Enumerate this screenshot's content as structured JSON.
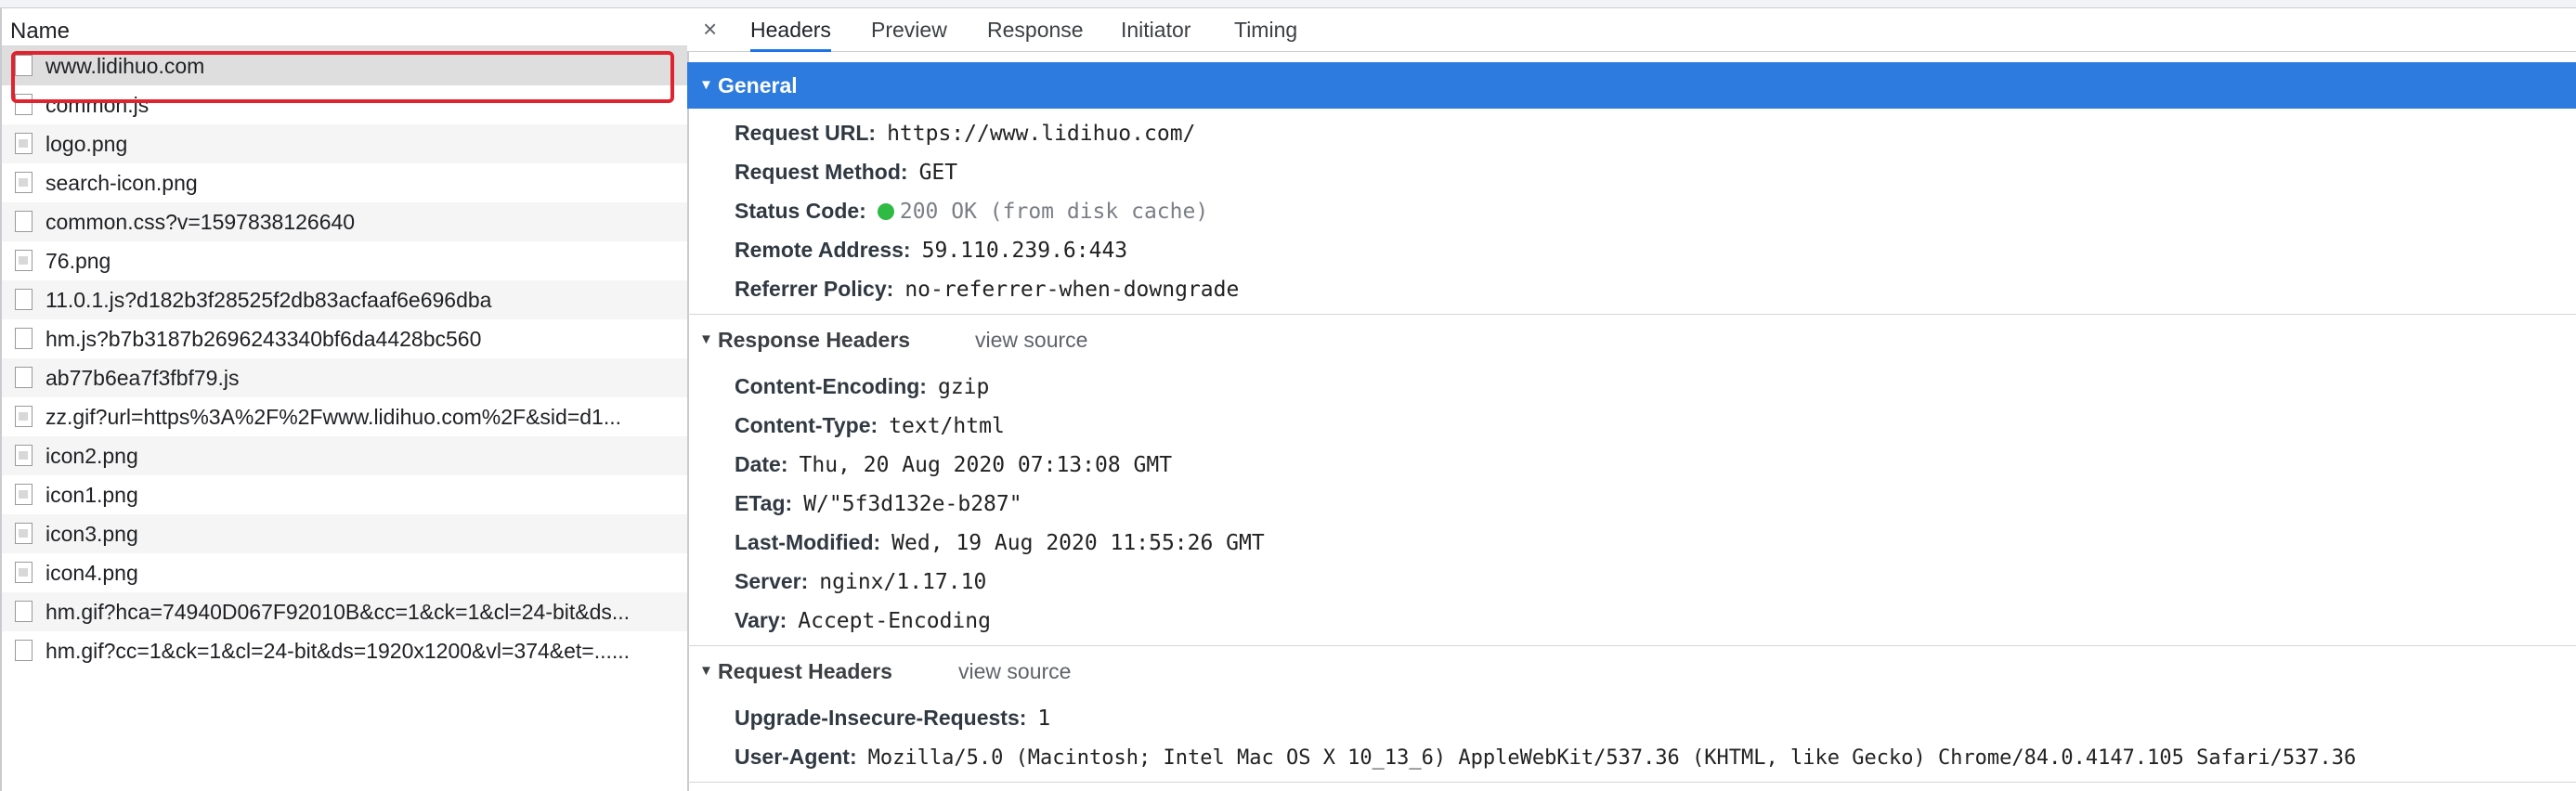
{
  "left": {
    "header": "Name",
    "requests": [
      {
        "name": "www.lidihuo.com",
        "icon": "document-icon"
      },
      {
        "name": "common.js",
        "icon": "document-icon"
      },
      {
        "name": "logo.png",
        "icon": "image-icon"
      },
      {
        "name": "search-icon.png",
        "icon": "image-icon"
      },
      {
        "name": "common.css?v=1597838126640",
        "icon": "document-icon"
      },
      {
        "name": "76.png",
        "icon": "image-icon"
      },
      {
        "name": "11.0.1.js?d182b3f28525f2db83acfaaf6e696dba",
        "icon": "document-icon"
      },
      {
        "name": "hm.js?b7b3187b2696243340bf6da4428bc560",
        "icon": "document-icon"
      },
      {
        "name": "ab77b6ea7f3fbf79.js",
        "icon": "document-icon"
      },
      {
        "name": "zz.gif?url=https%3A%2F%2Fwww.lidihuo.com%2F&sid=d1...",
        "icon": "image-icon"
      },
      {
        "name": "icon2.png",
        "icon": "image-icon"
      },
      {
        "name": "icon1.png",
        "icon": "image-icon"
      },
      {
        "name": "icon3.png",
        "icon": "image-icon"
      },
      {
        "name": "icon4.png",
        "icon": "image-icon"
      },
      {
        "name": "hm.gif?hca=74940D067F92010B&cc=1&ck=1&cl=24-bit&ds...",
        "icon": "document-icon"
      },
      {
        "name": "hm.gif?cc=1&ck=1&cl=24-bit&ds=1920x1200&vl=374&et=......",
        "icon": "document-icon"
      }
    ]
  },
  "tabs": {
    "close": "×",
    "items": [
      "Headers",
      "Preview",
      "Response",
      "Initiator",
      "Timing"
    ]
  },
  "general": {
    "title": "General",
    "rows": [
      {
        "key": "Request URL:",
        "value": "https://www.lidihuo.com/"
      },
      {
        "key": "Request Method:",
        "value": "GET"
      },
      {
        "key": "Status Code:",
        "value": "200 OK (from disk cache)"
      },
      {
        "key": "Remote Address:",
        "value": "59.110.239.6:443"
      },
      {
        "key": "Referrer Policy:",
        "value": "no-referrer-when-downgrade"
      }
    ]
  },
  "response_headers": {
    "title": "Response Headers",
    "view_source": "view source",
    "rows": [
      {
        "key": "Content-Encoding:",
        "value": "gzip"
      },
      {
        "key": "Content-Type:",
        "value": "text/html"
      },
      {
        "key": "Date:",
        "value": "Thu, 20 Aug 2020 07:13:08 GMT"
      },
      {
        "key": "ETag:",
        "value": "W/\"5f3d132e-b287\""
      },
      {
        "key": "Last-Modified:",
        "value": "Wed, 19 Aug 2020 11:55:26 GMT"
      },
      {
        "key": "Server:",
        "value": "nginx/1.17.10"
      },
      {
        "key": "Vary:",
        "value": "Accept-Encoding"
      }
    ]
  },
  "request_headers": {
    "title": "Request Headers",
    "view_source": "view source",
    "rows": [
      {
        "key": "Upgrade-Insecure-Requests:",
        "value": "1"
      },
      {
        "key": "User-Agent:",
        "value": "Mozilla/5.0 (Macintosh; Intel Mac OS X 10_13_6) AppleWebKit/537.36 (KHTML, like Gecko) Chrome/84.0.4147.105 Safari/537.36"
      }
    ]
  },
  "colors": {
    "general_bar": "#2d7bde",
    "status_ok": "#2fba44",
    "selection_outline": "#e0232e"
  }
}
